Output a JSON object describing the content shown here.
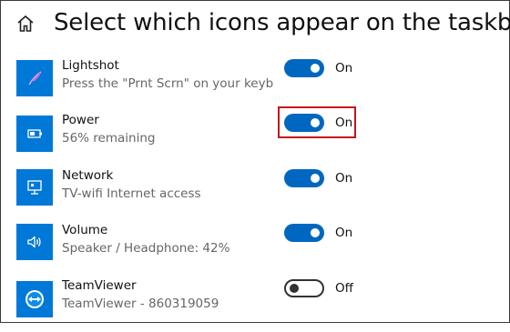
{
  "header": {
    "home_icon": "home-icon",
    "title": "Select which icons appear on the taskbar"
  },
  "items": [
    {
      "name": "Lightshot",
      "description": "Press the \"Prnt Scrn\" on your keyboard",
      "state": "On",
      "enabled": true,
      "icon": "feather-icon"
    },
    {
      "name": "Power",
      "description": "56% remaining",
      "state": "On",
      "enabled": true,
      "icon": "battery-icon"
    },
    {
      "name": "Network",
      "description": "TV-wifi Internet access",
      "state": "On",
      "enabled": true,
      "icon": "network-icon"
    },
    {
      "name": "Volume",
      "description": "Speaker / Headphone: 42%",
      "state": "On",
      "enabled": true,
      "icon": "speaker-icon"
    },
    {
      "name": "TeamViewer",
      "description": "TeamViewer - 860319059",
      "state": "Off",
      "enabled": false,
      "icon": "teamviewer-icon"
    }
  ],
  "colors": {
    "accent": "#0067c0",
    "tile": "#0078d7",
    "highlight": "#c4161c"
  }
}
